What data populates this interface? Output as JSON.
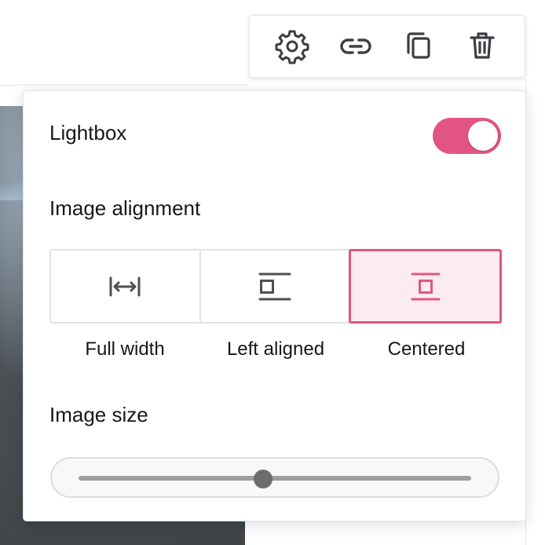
{
  "toolbar": {
    "buttons": [
      {
        "icon": "gear-icon"
      },
      {
        "icon": "link-icon"
      },
      {
        "icon": "copy-icon"
      },
      {
        "icon": "trash-icon"
      }
    ],
    "icon_color": "#3b3e42"
  },
  "panel": {
    "lightbox": {
      "label": "Lightbox",
      "enabled": true
    },
    "alignment": {
      "label": "Image alignment",
      "options": [
        {
          "label": "Full width",
          "icon": "full-width-icon",
          "selected": false
        },
        {
          "label": "Left aligned",
          "icon": "left-aligned-icon",
          "selected": false
        },
        {
          "label": "Centered",
          "icon": "centered-icon",
          "selected": true
        }
      ]
    },
    "size": {
      "label": "Image size",
      "value_fraction": 0.47
    }
  },
  "colors": {
    "accent": "#e25583",
    "accent_light": "#fcecf2",
    "icon": "#3b3e42",
    "text": "#15171a"
  }
}
